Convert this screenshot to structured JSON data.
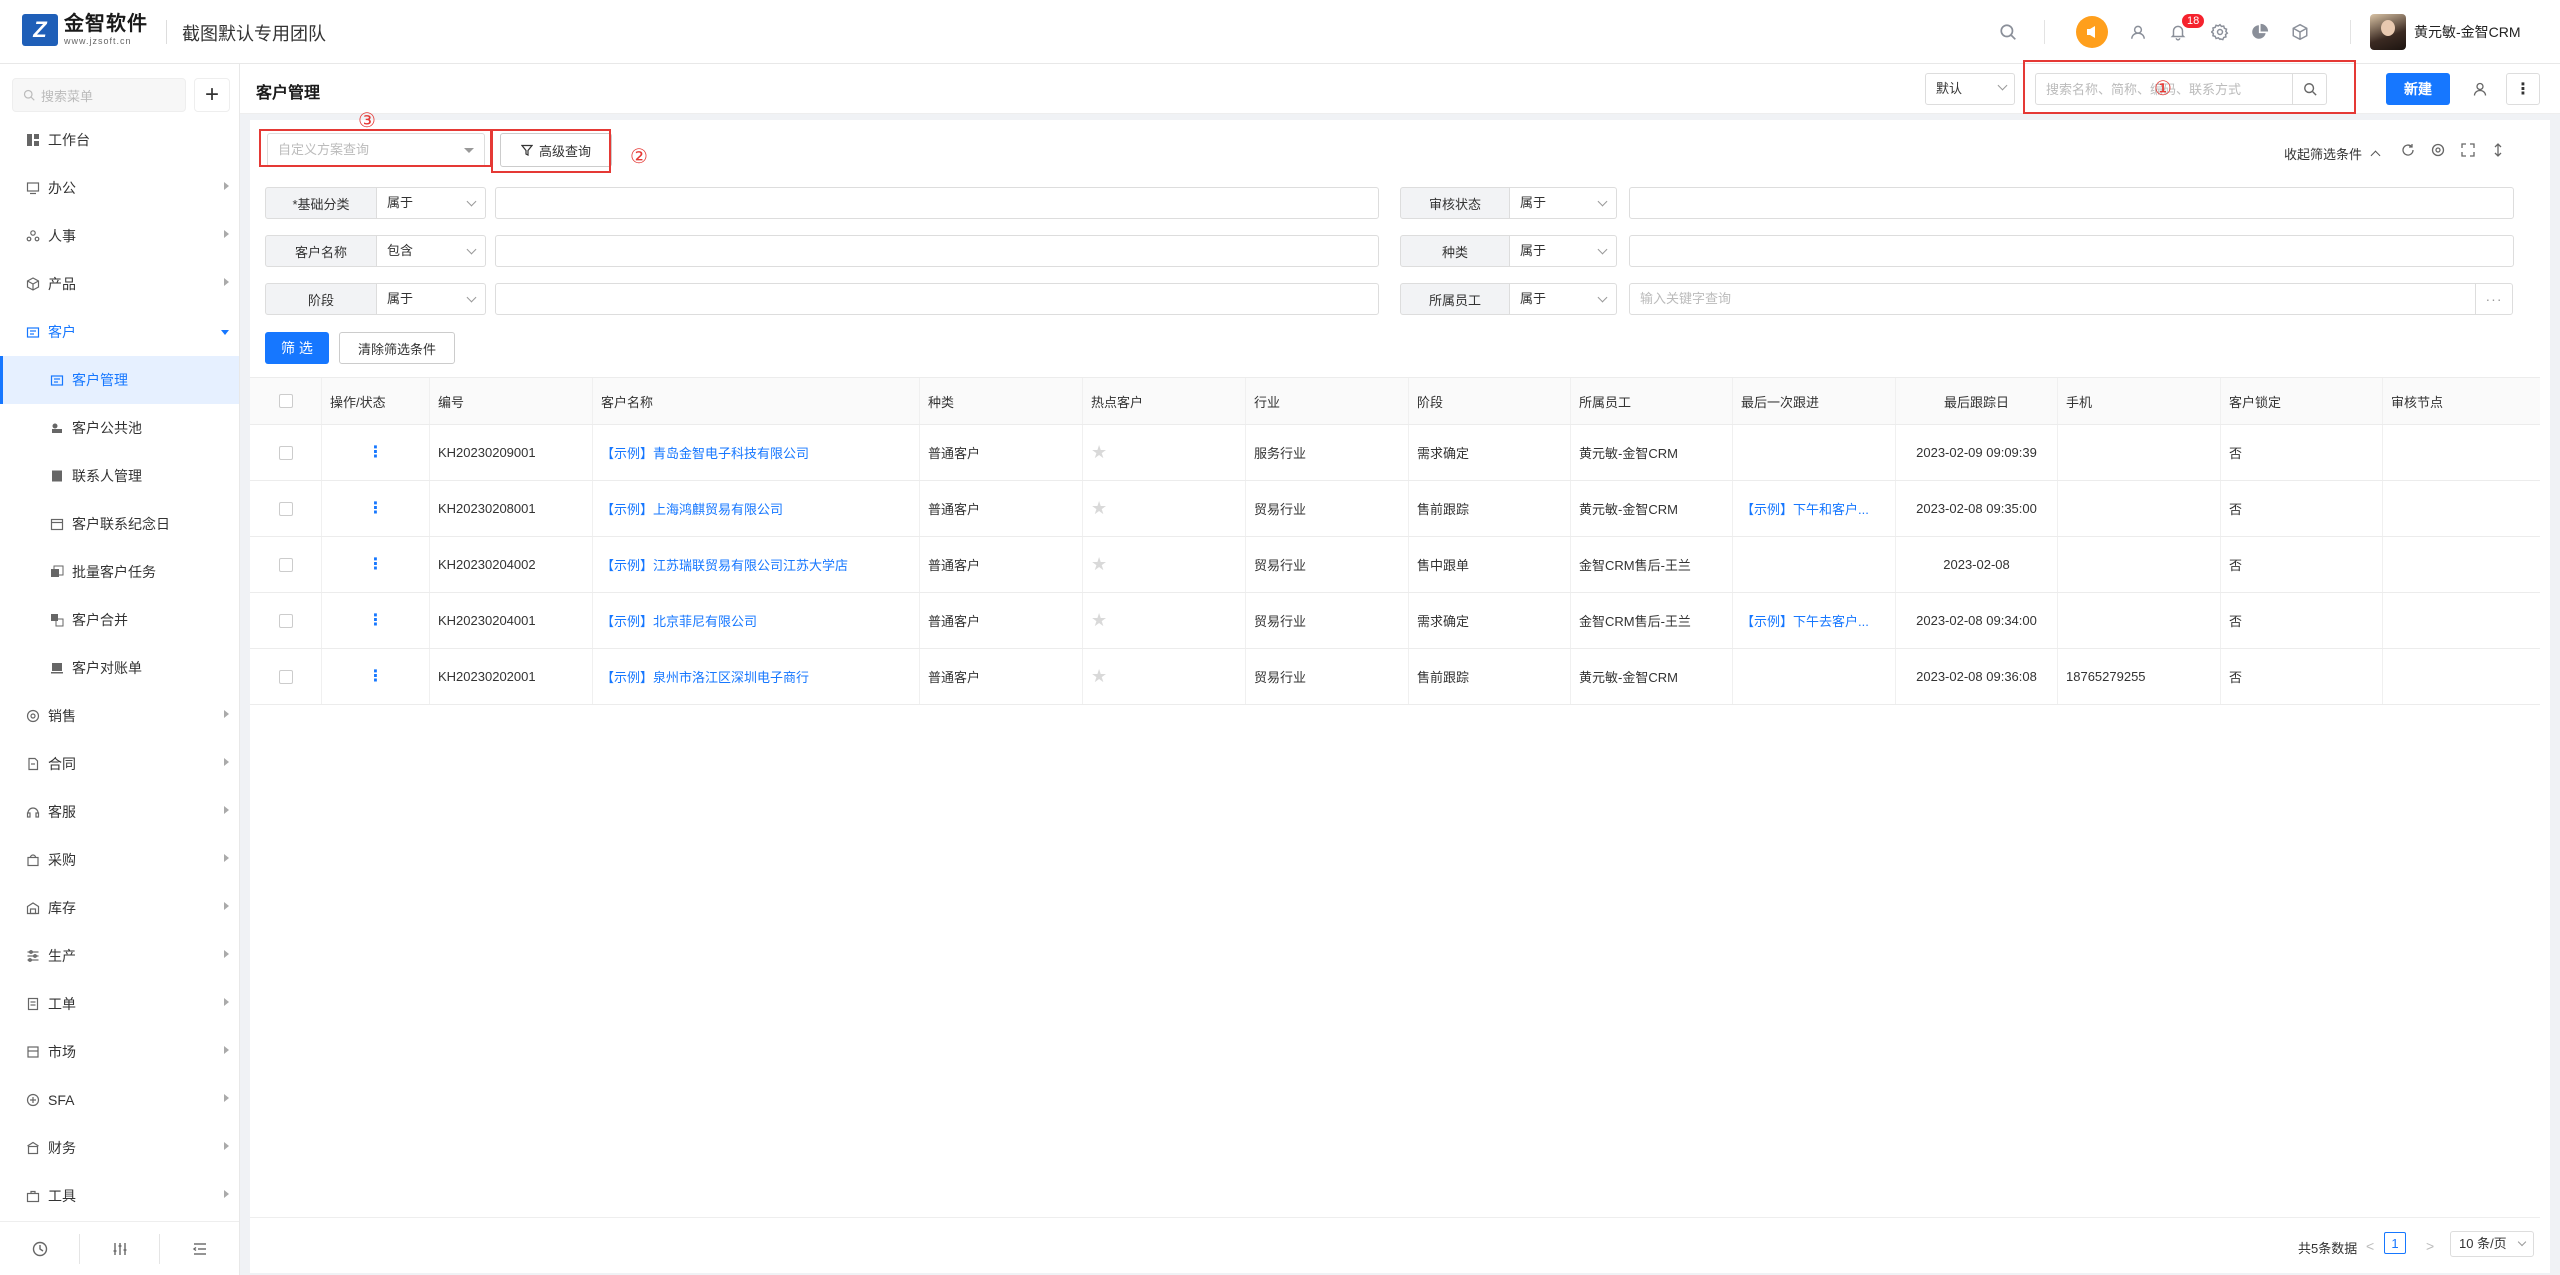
{
  "topbar": {
    "logo_mark": "Z",
    "logo_name": "金智软件",
    "logo_url": "www.jzsoft.cn",
    "team_name": "截图默认专用团队",
    "notification_count": "18",
    "user_name": "黄元敏-金智CRM"
  },
  "sidebar": {
    "search_placeholder": "搜索菜单",
    "add_label": "+",
    "items": [
      {
        "label": "工作台",
        "icon": "dashboard-icon"
      },
      {
        "label": "办公",
        "icon": "office-icon"
      },
      {
        "label": "人事",
        "icon": "people-icon"
      },
      {
        "label": "产品",
        "icon": "product-icon"
      },
      {
        "label": "客户",
        "icon": "customer-icon"
      },
      {
        "label": "客户管理",
        "icon": "customer-manage-icon"
      },
      {
        "label": "客户公共池",
        "icon": "pool-icon"
      },
      {
        "label": "联系人管理",
        "icon": "contact-icon"
      },
      {
        "label": "客户联系纪念日",
        "icon": "calendar-icon"
      },
      {
        "label": "批量客户任务",
        "icon": "batch-icon"
      },
      {
        "label": "客户合并",
        "icon": "merge-icon"
      },
      {
        "label": "客户对账单",
        "icon": "statement-icon"
      },
      {
        "label": "销售",
        "icon": "sales-icon"
      },
      {
        "label": "合同",
        "icon": "contract-icon"
      },
      {
        "label": "客服",
        "icon": "service-icon"
      },
      {
        "label": "采购",
        "icon": "purchase-icon"
      },
      {
        "label": "库存",
        "icon": "inventory-icon"
      },
      {
        "label": "生产",
        "icon": "production-icon"
      },
      {
        "label": "工单",
        "icon": "workorder-icon"
      },
      {
        "label": "市场",
        "icon": "market-icon"
      },
      {
        "label": "SFA",
        "icon": "sfa-icon"
      },
      {
        "label": "财务",
        "icon": "finance-icon"
      },
      {
        "label": "工具",
        "icon": "tools-icon"
      }
    ]
  },
  "header": {
    "page_title": "客户管理",
    "view_select": "默认",
    "search_placeholder": "搜索名称、简称、编码、联系方式",
    "new_label": "新建",
    "more_label": "⋮"
  },
  "annotations": [
    "①",
    "②",
    "③"
  ],
  "filters": {
    "scheme_placeholder": "自定义方案查询",
    "advanced_label": "高级查询",
    "collapse_label": "收起筛选条件",
    "rows": [
      {
        "label": "*基础分类",
        "op": "属于",
        "label2": "审核状态",
        "op2": "属于"
      },
      {
        "label": "客户名称",
        "op": "包含",
        "label2": "种类",
        "op2": "属于"
      },
      {
        "label": "阶段",
        "op": "属于",
        "label2": "所属员工",
        "op2": "属于",
        "placeholder2": "输入关键字查询"
      }
    ],
    "filter_btn": "筛 选",
    "clear_btn": "清除筛选条件"
  },
  "table": {
    "columns": [
      "操作/状态",
      "编号",
      "客户名称",
      "种类",
      "热点客户",
      "行业",
      "阶段",
      "所属员工",
      "最后一次跟进",
      "最后跟踪日",
      "手机",
      "客户锁定",
      "审核节点"
    ],
    "rows": [
      {
        "id": "KH20230209001",
        "name": "【示例】青岛金智电子科技有限公司",
        "kind": "普通客户",
        "industry": "服务行业",
        "stage": "需求确定",
        "owner": "黄元敏-金智CRM",
        "last_follow": "",
        "last_date": "2023-02-09 09:09:39",
        "phone": "",
        "locked": "否"
      },
      {
        "id": "KH20230208001",
        "name": "【示例】上海鸿麒贸易有限公司",
        "kind": "普通客户",
        "industry": "贸易行业",
        "stage": "售前跟踪",
        "owner": "黄元敏-金智CRM",
        "last_follow": "【示例】下午和客户...",
        "last_date": "2023-02-08 09:35:00",
        "phone": "",
        "locked": "否"
      },
      {
        "id": "KH20230204002",
        "name": "【示例】江苏瑞联贸易有限公司江苏大学店",
        "kind": "普通客户",
        "industry": "贸易行业",
        "stage": "售中跟单",
        "owner": "金智CRM售后-王兰",
        "last_follow": "",
        "last_date": "2023-02-08",
        "phone": "",
        "locked": "否"
      },
      {
        "id": "KH20230204001",
        "name": "【示例】北京菲尼有限公司",
        "kind": "普通客户",
        "industry": "贸易行业",
        "stage": "需求确定",
        "owner": "金智CRM售后-王兰",
        "last_follow": "【示例】下午去客户...",
        "last_date": "2023-02-08 09:34:00",
        "phone": "",
        "locked": "否"
      },
      {
        "id": "KH20230202001",
        "name": "【示例】泉州市洛江区深圳电子商行",
        "kind": "普通客户",
        "industry": "贸易行业",
        "stage": "售前跟踪",
        "owner": "黄元敏-金智CRM",
        "last_follow": "",
        "last_date": "2023-02-08 09:36:08",
        "phone": "18765279255",
        "locked": "否"
      }
    ]
  },
  "pagination": {
    "total": "共5条数据",
    "prev": "<",
    "page": "1",
    "next": ">",
    "page_size": "10 条/页"
  },
  "colors": {
    "accent": "#1677ff",
    "annotation": "#e53935",
    "orange": "#ff9f1c"
  }
}
